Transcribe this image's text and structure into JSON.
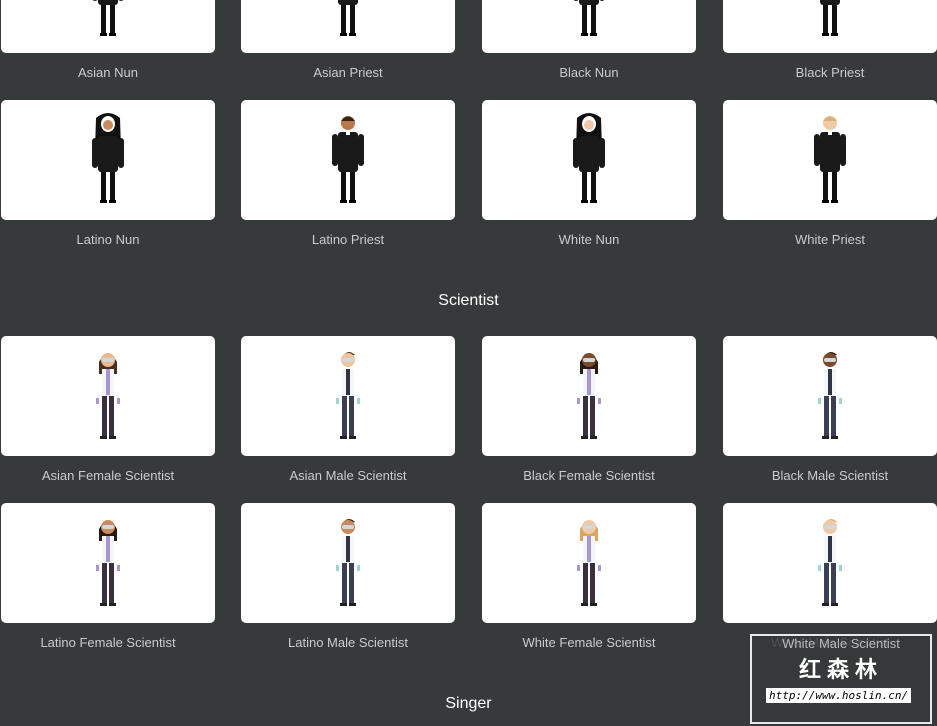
{
  "sections": [
    {
      "heading": null,
      "rows": [
        {
          "top": true,
          "items": [
            {
              "label": "Asian Nun",
              "type": "nun",
              "skin": "#e9b98f",
              "hair": "#222"
            },
            {
              "label": "Asian Priest",
              "type": "priest",
              "skin": "#e9b98f",
              "hair": "#222"
            },
            {
              "label": "Black Nun",
              "type": "nun",
              "skin": "#7a4a2a",
              "hair": "#222"
            },
            {
              "label": "Black Priest",
              "type": "priest",
              "skin": "#7a4a2a",
              "hair": "#222"
            }
          ]
        },
        {
          "items": [
            {
              "label": "Latino Nun",
              "type": "nun",
              "skin": "#c98a5e",
              "hair": "#222"
            },
            {
              "label": "Latino Priest",
              "type": "priest",
              "skin": "#b9794d",
              "hair": "#3b2414"
            },
            {
              "label": "White Nun",
              "type": "nun",
              "skin": "#f2c9a6",
              "hair": "#222"
            },
            {
              "label": "White Priest",
              "type": "priest",
              "skin": "#f2c9a6",
              "hair": "#d9b27a"
            }
          ]
        }
      ]
    },
    {
      "heading": "Scientist",
      "rows": [
        {
          "items": [
            {
              "label": "Asian Female Scientist",
              "type": "fsci",
              "skin": "#e9b98f",
              "hair": "#4a2e1e"
            },
            {
              "label": "Asian Male Scientist",
              "type": "msci",
              "skin": "#f0c49d",
              "hair": "#5a3a22"
            },
            {
              "label": "Black Female Scientist",
              "type": "fsci",
              "skin": "#7a4a2a",
              "hair": "#2a1a10"
            },
            {
              "label": "Black Male Scientist",
              "type": "msci",
              "skin": "#7a4a2a",
              "hair": "#2a1a10"
            }
          ]
        },
        {
          "items": [
            {
              "label": "Latino Female Scientist",
              "type": "fsci",
              "skin": "#c98a5e",
              "hair": "#2a1a10"
            },
            {
              "label": "Latino Male Scientist",
              "type": "msci",
              "skin": "#c98a5e",
              "hair": "#3b2414"
            },
            {
              "label": "White Female Scientist",
              "type": "fsci",
              "skin": "#f2c9a6",
              "hair": "#d9a55c"
            },
            {
              "label": "White Male Scientist",
              "type": "msci",
              "skin": "#f2c9a6",
              "hair": "#d9b27a"
            }
          ]
        }
      ]
    },
    {
      "heading": "Singer",
      "rows": []
    }
  ],
  "watermark": {
    "chinese": "红森林",
    "url": "http://www.hoslin.cn/"
  }
}
